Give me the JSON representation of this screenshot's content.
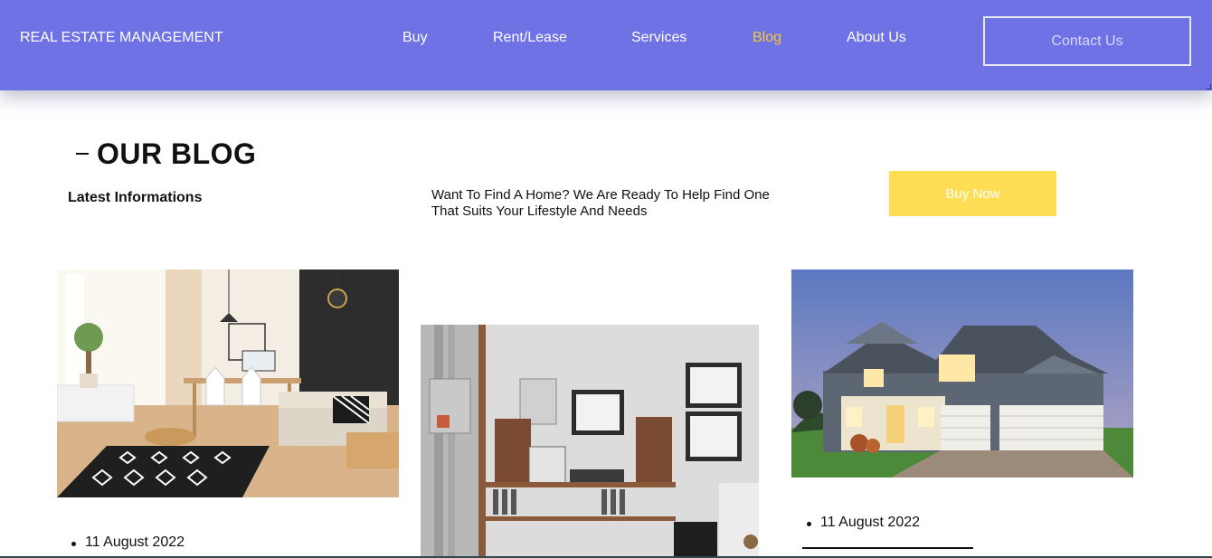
{
  "header": {
    "brand": "REAL ESTATE MANAGEMENT",
    "nav": [
      {
        "label": "Buy"
      },
      {
        "label": "Rent/Lease"
      },
      {
        "label": "Services"
      },
      {
        "label": "Blog",
        "active": true
      },
      {
        "label": "About Us"
      }
    ],
    "contact_label": "Contact Us"
  },
  "section": {
    "title": "OUR BLOG",
    "subtitle": "Latest Informations",
    "intro": "Want To Find A Home? We Are Ready To Help Find One That Suits Your Lifestyle And Needs",
    "buy_label": "Buy Now"
  },
  "cards": [
    {
      "date": "11 August 2022"
    },
    {
      "date": ""
    },
    {
      "date": "11 August 2022"
    }
  ],
  "colors": {
    "header_bg": "#6f72e5",
    "active_nav": "#f5c83a",
    "buy_button": "#ffdd55"
  }
}
